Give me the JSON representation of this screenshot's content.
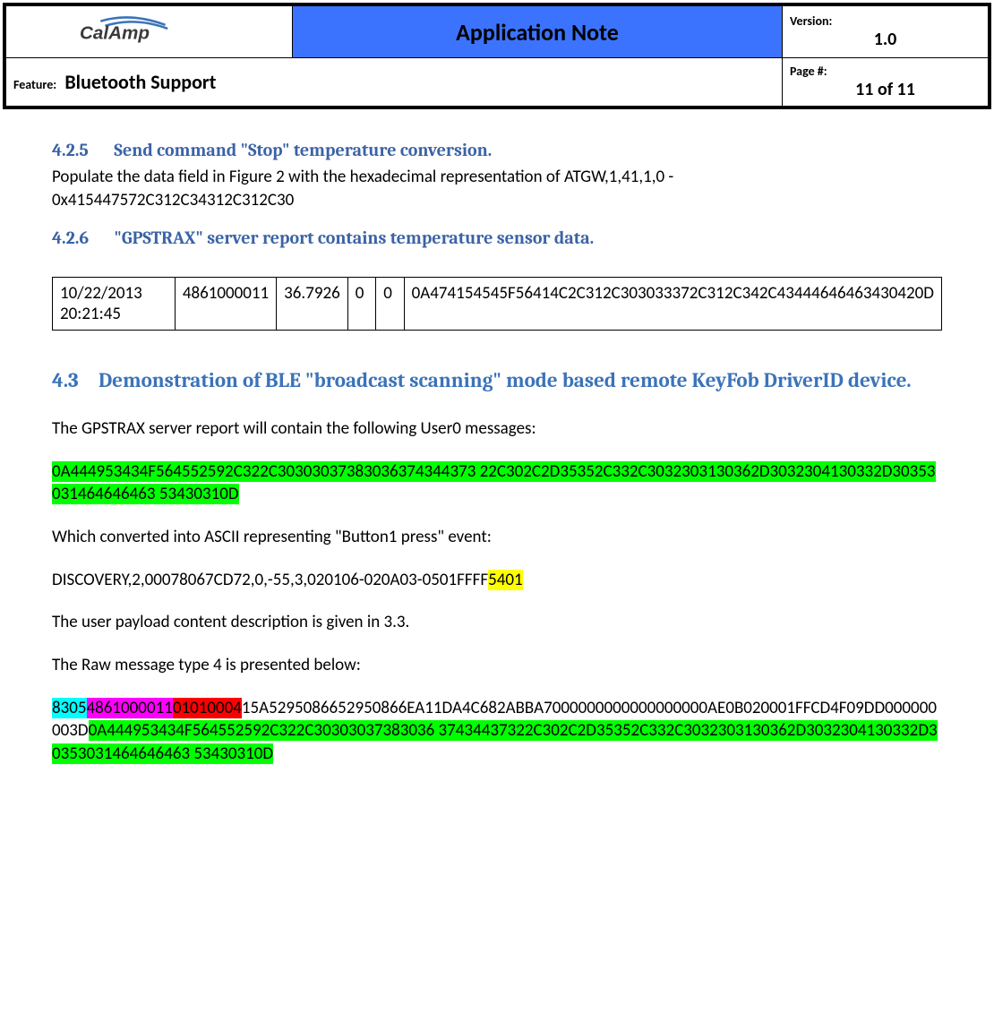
{
  "header": {
    "title": "Application Note",
    "version_label": "Version:",
    "version_value": "1.0",
    "feature_label": "Feature:",
    "feature_value": "Bluetooth Support",
    "page_label": "Page #:",
    "page_value": "11 of 11",
    "logo_name": "CalAmp"
  },
  "sec_425": {
    "num": "4.2.5",
    "title": "Send command \"Stop\" temperature conversion.",
    "body_a": "Populate the data field in Figure 2 with the hexadecimal representation of  ATGW,1,41,1,0 -",
    "body_b": "0x415447572C312C34312C312C30"
  },
  "sec_426": {
    "num": "4.2.6",
    "title": "\"GPSTRAX\" server report contains temperature sensor data."
  },
  "table": {
    "timestamp": "10/22/2013 20:21:45",
    "id": "4861000011",
    "num": "36.7926",
    "z1": "0",
    "z2": "0",
    "hex": "0A474154545F56414C2C312C303033372C312C342C43444646463430420D"
  },
  "sec_43": {
    "num": "4.3",
    "title": "Demonstration of BLE \"broadcast scanning\" mode based remote KeyFob DriverID device."
  },
  "para1": "The GPSTRAX server report will contain the following User0 messages:",
  "hex_green1": "0A444953434F564552592C322C30303037383036374344373 22C302C2D35352C332C3032303130362D3032304130332D30353031464646463 53430310D",
  "para2": "Which converted into ASCII representing \"Button1 press\" event:",
  "discovery_line": {
    "prefix": "DISCOVERY,2,00078067CD72,0,-55,3,020106-020A03-0501FFFF",
    "hl": "5401"
  },
  "para3": "The user payload content description is given in 3.3.",
  "para4": "The Raw message type 4 is presented below:",
  "raw4": {
    "s1": "8305",
    "s2": "4861000011",
    "s3": "01010004",
    "mid": "15A5295086652950866EA11DA4C682ABBA7000000000000000000AE0B020001FFCD4F09DD000000003D",
    "s4": "0A444953434F564552592C322C30303037383036 37434437322C302C2D35352C332C3032303130362D3032304130332D30353031464646463 53430310D"
  }
}
